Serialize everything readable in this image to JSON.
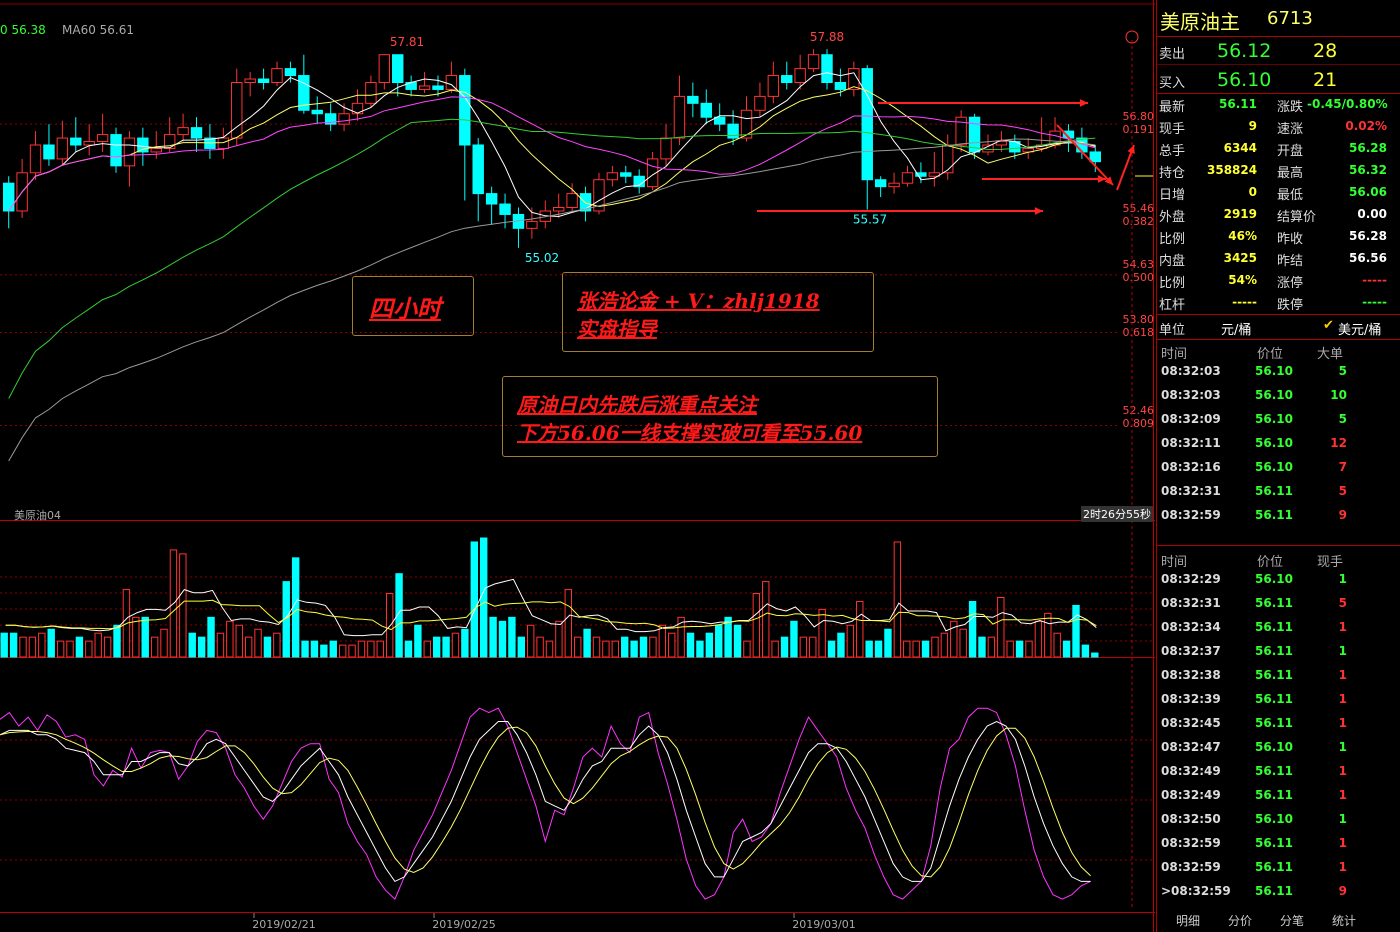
{
  "symbol": {
    "name": "美原油主",
    "code": "6713"
  },
  "indicator_readout": {
    "ma_a": "0 56.38",
    "ma60": "MA60 56.61"
  },
  "main_label": "美原油04",
  "countdown": "2时26分55秒",
  "quote": {
    "sell": {
      "label": "卖出",
      "price": "56.12",
      "qty": "28"
    },
    "buy": {
      "label": "买入",
      "price": "56.10",
      "qty": "21"
    }
  },
  "stats": [
    {
      "l1": "最新",
      "v1": "56.11",
      "c1": "green",
      "l2": "涨跌",
      "v2": "-0.45/0.80%",
      "c2": "green"
    },
    {
      "l1": "现手",
      "v1": "9",
      "c1": "yellow",
      "l2": "速涨",
      "v2": "0.02%",
      "c2": "red"
    },
    {
      "l1": "总手",
      "v1": "6344",
      "c1": "yellow",
      "l2": "开盘",
      "v2": "56.28",
      "c2": "green"
    },
    {
      "l1": "持仓",
      "v1": "358824",
      "c1": "yellow",
      "l2": "最高",
      "v2": "56.32",
      "c2": "green"
    },
    {
      "l1": "日增",
      "v1": "0",
      "c1": "yellow",
      "l2": "最低",
      "v2": "56.06",
      "c2": "green"
    },
    {
      "l1": "外盘",
      "v1": "2919",
      "c1": "yellow",
      "l2": "结算价",
      "v2": "0.00",
      "c2": "white"
    },
    {
      "l1": "比例",
      "v1": "46%",
      "c1": "yellow",
      "l2": "昨收",
      "v2": "56.28",
      "c2": "white"
    },
    {
      "l1": "内盘",
      "v1": "3425",
      "c1": "yellow",
      "l2": "昨结",
      "v2": "56.56",
      "c2": "white"
    },
    {
      "l1": "比例",
      "v1": "54%",
      "c1": "yellow",
      "l2": "涨停",
      "v2": "-----",
      "c2": "red"
    },
    {
      "l1": "杠杆",
      "v1": "-----",
      "c1": "yellow",
      "l2": "跌停",
      "v2": "-----",
      "c2": "green"
    }
  ],
  "unit": {
    "label": "单位",
    "opt1": "元/桶",
    "opt2": "美元/桶"
  },
  "ticks_big": {
    "headers": [
      "时间",
      "价位",
      "大单"
    ],
    "rows": [
      [
        "08:32:03",
        "56.10",
        "5",
        "green"
      ],
      [
        "08:32:03",
        "56.10",
        "10",
        "green"
      ],
      [
        "08:32:09",
        "56.10",
        "5",
        "green"
      ],
      [
        "08:32:11",
        "56.10",
        "12",
        "red"
      ],
      [
        "08:32:16",
        "56.10",
        "7",
        "red"
      ],
      [
        "08:32:31",
        "56.11",
        "5",
        "red"
      ],
      [
        "08:32:59",
        "56.11",
        "9",
        "red"
      ]
    ]
  },
  "ticks": {
    "headers": [
      "时间",
      "价位",
      "现手"
    ],
    "rows": [
      [
        "08:32:29",
        "56.10",
        "1",
        "green"
      ],
      [
        "08:32:31",
        "56.11",
        "5",
        "red"
      ],
      [
        "08:32:34",
        "56.11",
        "1",
        "red"
      ],
      [
        "08:32:37",
        "56.11",
        "1",
        "green"
      ],
      [
        "08:32:38",
        "56.11",
        "1",
        "red"
      ],
      [
        "08:32:39",
        "56.11",
        "1",
        "red"
      ],
      [
        "08:32:45",
        "56.11",
        "1",
        "red"
      ],
      [
        "08:32:47",
        "56.10",
        "1",
        "green"
      ],
      [
        "08:32:49",
        "56.11",
        "1",
        "red"
      ],
      [
        "08:32:49",
        "56.11",
        "1",
        "red"
      ],
      [
        "08:32:50",
        "56.10",
        "1",
        "green"
      ],
      [
        "08:32:59",
        "56.11",
        "1",
        "red"
      ],
      [
        "08:32:59",
        "56.11",
        "1",
        "red"
      ],
      [
        ">08:32:59",
        "56.11",
        "9",
        "red"
      ]
    ]
  },
  "tabs": [
    "明细",
    "分价",
    "分笔",
    "统计"
  ],
  "annotations": {
    "box1": "四小时",
    "box2_line1": "张浩论金 + V：zhlj1918",
    "box2_line2": "实盘指导",
    "box3_line1": "原油日内先跌后涨重点关注",
    "box3_line2": "下方56.06一线支撑实破可看至55.60"
  },
  "colors": {
    "up": "#ff3333",
    "down": "#00ffff",
    "bg": "#000000",
    "grid": "#8b0000"
  },
  "chart_data": {
    "type": "candlestick",
    "price_axis": {
      "ticks": [
        {
          "price": "56.80",
          "pct": "0.191"
        },
        {
          "price": "55.46",
          "pct": "0.382"
        },
        {
          "price": "54.63",
          "pct": "0.500"
        },
        {
          "price": "53.80",
          "pct": "0.618"
        },
        {
          "price": "52.46",
          "pct": "0.809"
        }
      ]
    },
    "price_labels": [
      "57.81",
      "57.88",
      "55.02",
      "55.57"
    ],
    "date_labels": [
      "2019/02/21",
      "2019/02/25",
      "2019/03/01"
    ],
    "ylim": [
      51.1,
      58.3
    ],
    "candles": [
      [
        55.95,
        55.55,
        56.05,
        55.3
      ],
      [
        55.55,
        56.1,
        56.3,
        55.45
      ],
      [
        56.1,
        56.5,
        56.7,
        56.0
      ],
      [
        56.5,
        56.3,
        56.8,
        56.2
      ],
      [
        56.3,
        56.6,
        56.85,
        56.2
      ],
      [
        56.6,
        56.5,
        56.9,
        56.4
      ],
      [
        56.5,
        56.55,
        56.8,
        56.35
      ],
      [
        56.55,
        56.65,
        56.95,
        56.4
      ],
      [
        56.65,
        56.2,
        56.75,
        56.1
      ],
      [
        56.2,
        56.6,
        56.7,
        55.9
      ],
      [
        56.6,
        56.4,
        56.75,
        56.2
      ],
      [
        56.4,
        56.45,
        56.7,
        56.3
      ],
      [
        56.45,
        56.65,
        56.9,
        56.4
      ],
      [
        56.65,
        56.75,
        56.95,
        56.55
      ],
      [
        56.75,
        56.6,
        56.9,
        56.4
      ],
      [
        56.6,
        56.45,
        56.8,
        56.3
      ],
      [
        56.45,
        56.6,
        56.75,
        56.3
      ],
      [
        56.6,
        57.4,
        57.6,
        56.5
      ],
      [
        57.4,
        57.45,
        57.55,
        57.2
      ],
      [
        57.45,
        57.4,
        57.6,
        57.3
      ],
      [
        57.4,
        57.6,
        57.7,
        57.35
      ],
      [
        57.6,
        57.5,
        57.7,
        57.4
      ],
      [
        57.5,
        57.0,
        57.8,
        56.95
      ],
      [
        57.0,
        56.95,
        57.2,
        56.8
      ],
      [
        56.95,
        56.8,
        57.1,
        56.7
      ],
      [
        56.8,
        56.95,
        57.1,
        56.7
      ],
      [
        56.95,
        57.1,
        57.3,
        56.85
      ],
      [
        57.1,
        57.4,
        57.5,
        57.05
      ],
      [
        57.4,
        57.8,
        57.81,
        57.3
      ],
      [
        57.8,
        57.4,
        57.8,
        57.2
      ],
      [
        57.4,
        57.3,
        57.5,
        57.2
      ],
      [
        57.3,
        57.35,
        57.55,
        57.25
      ],
      [
        57.35,
        57.3,
        57.5,
        57.2
      ],
      [
        57.3,
        57.5,
        57.7,
        57.25
      ],
      [
        57.5,
        56.5,
        57.6,
        55.7
      ],
      [
        56.5,
        55.8,
        56.6,
        55.4
      ],
      [
        55.8,
        55.65,
        55.9,
        55.35
      ],
      [
        55.65,
        55.5,
        55.8,
        55.3
      ],
      [
        55.5,
        55.3,
        55.6,
        55.02
      ],
      [
        55.3,
        55.4,
        55.6,
        55.15
      ],
      [
        55.4,
        55.55,
        55.7,
        55.3
      ],
      [
        55.55,
        55.6,
        55.8,
        55.45
      ],
      [
        55.6,
        55.8,
        55.95,
        55.55
      ],
      [
        55.8,
        55.55,
        55.9,
        55.4
      ],
      [
        55.55,
        56.0,
        56.1,
        55.5
      ],
      [
        56.0,
        56.1,
        56.2,
        55.9
      ],
      [
        56.1,
        56.05,
        56.2,
        55.95
      ],
      [
        56.05,
        55.9,
        56.15,
        55.8
      ],
      [
        55.9,
        56.3,
        56.4,
        55.85
      ],
      [
        56.3,
        56.6,
        56.8,
        56.2
      ],
      [
        56.6,
        57.2,
        57.5,
        56.5
      ],
      [
        57.2,
        57.1,
        57.4,
        56.9
      ],
      [
        57.1,
        56.9,
        57.3,
        56.8
      ],
      [
        56.9,
        56.8,
        57.1,
        56.7
      ],
      [
        56.8,
        56.6,
        57.0,
        56.5
      ],
      [
        56.6,
        57.0,
        57.2,
        56.55
      ],
      [
        57.0,
        57.2,
        57.4,
        56.9
      ],
      [
        57.2,
        57.5,
        57.7,
        57.1
      ],
      [
        57.5,
        57.4,
        57.7,
        57.3
      ],
      [
        57.4,
        57.6,
        57.8,
        57.3
      ],
      [
        57.6,
        57.8,
        57.88,
        57.55
      ],
      [
        57.8,
        57.4,
        57.88,
        57.3
      ],
      [
        57.4,
        57.3,
        57.6,
        57.2
      ],
      [
        57.3,
        57.6,
        57.7,
        57.2
      ],
      [
        57.6,
        56.0,
        57.65,
        55.57
      ],
      [
        56.0,
        55.9,
        56.05,
        55.75
      ],
      [
        55.9,
        55.95,
        56.1,
        55.8
      ],
      [
        55.95,
        56.1,
        56.2,
        55.9
      ],
      [
        56.1,
        56.05,
        56.25,
        55.95
      ],
      [
        56.05,
        56.1,
        56.4,
        55.9
      ],
      [
        56.1,
        56.5,
        56.65,
        56.0
      ],
      [
        56.5,
        56.9,
        57.0,
        56.4
      ],
      [
        56.9,
        56.4,
        56.95,
        56.3
      ],
      [
        56.4,
        56.5,
        56.65,
        56.35
      ],
      [
        56.5,
        56.55,
        56.7,
        56.4
      ],
      [
        56.55,
        56.4,
        56.65,
        56.3
      ],
      [
        56.4,
        56.45,
        56.6,
        56.3
      ],
      [
        56.45,
        56.5,
        56.9,
        56.4
      ],
      [
        56.5,
        56.7,
        56.9,
        56.45
      ],
      [
        56.7,
        56.6,
        56.8,
        56.4
      ],
      [
        56.6,
        56.4,
        56.75,
        56.3
      ],
      [
        56.4,
        56.26,
        56.5,
        56.11
      ]
    ]
  },
  "volume_data": [
    6,
    6,
    5,
    5,
    6,
    7,
    4,
    4,
    5,
    4,
    6,
    5,
    8,
    17,
    10,
    10,
    5,
    7,
    27,
    26,
    6,
    5,
    10,
    6,
    9,
    8,
    5,
    7,
    5,
    6,
    19,
    25,
    4,
    4,
    3,
    4,
    3,
    3,
    4,
    4,
    4,
    16,
    21,
    4,
    8,
    4,
    5,
    5,
    6,
    7,
    29,
    30,
    10,
    9,
    10,
    5,
    8,
    5,
    4,
    9,
    17,
    5,
    7,
    5,
    4,
    4,
    5,
    4,
    5,
    5,
    8,
    6,
    10,
    6,
    4,
    6,
    8,
    10,
    8,
    4,
    16,
    19,
    4,
    5,
    9,
    5,
    5,
    12,
    4,
    6,
    8,
    14,
    4,
    4,
    7,
    29,
    4,
    4,
    4,
    5,
    6,
    9,
    7,
    14,
    5,
    5,
    15,
    4,
    4,
    4,
    9,
    11,
    6,
    4,
    13,
    3,
    1
  ],
  "oscillator": {
    "magenta": [
      85,
      88,
      82,
      86,
      80,
      87,
      84,
      77,
      78,
      76,
      60,
      55,
      62,
      59,
      72,
      63,
      70,
      71,
      70,
      58,
      64,
      75,
      80,
      79,
      72,
      60,
      54,
      46,
      40,
      46,
      56,
      66,
      72,
      74,
      74,
      58,
      52,
      38,
      30,
      24,
      14,
      8,
      4,
      14,
      26,
      34,
      42,
      52,
      62,
      74,
      86,
      90,
      88,
      90,
      82,
      70,
      58,
      46,
      30,
      44,
      42,
      54,
      68,
      72,
      68,
      82,
      74,
      70,
      86,
      88,
      70,
      56,
      40,
      22,
      10,
      4,
      6,
      14,
      34,
      40,
      30,
      32,
      38,
      52,
      64,
      76,
      86,
      80,
      74,
      68,
      54,
      44,
      36,
      24,
      14,
      6,
      4,
      8,
      12,
      28,
      54,
      72,
      76,
      86,
      90,
      90,
      88,
      78,
      64,
      44,
      26,
      14,
      6,
      4,
      6,
      10,
      12
    ],
    "white": [
      78,
      80,
      80,
      80,
      78,
      78,
      76,
      72,
      71,
      70,
      66,
      60,
      60,
      60,
      66,
      66,
      68,
      70,
      70,
      65,
      64,
      68,
      74,
      76,
      74,
      68,
      62,
      56,
      50,
      48,
      52,
      58,
      64,
      68,
      72,
      66,
      60,
      50,
      42,
      34,
      26,
      18,
      12,
      14,
      20,
      26,
      32,
      40,
      48,
      58,
      68,
      76,
      80,
      84,
      84,
      78,
      70,
      60,
      48,
      46,
      44,
      50,
      58,
      64,
      66,
      72,
      72,
      72,
      78,
      82,
      78,
      70,
      58,
      44,
      32,
      20,
      14,
      14,
      22,
      30,
      32,
      34,
      38,
      46,
      54,
      62,
      70,
      74,
      74,
      72,
      66,
      58,
      50,
      40,
      30,
      20,
      14,
      12,
      12,
      18,
      32,
      46,
      58,
      68,
      76,
      82,
      84,
      82,
      76,
      64,
      50,
      38,
      28,
      20,
      14,
      12,
      12
    ]
  }
}
